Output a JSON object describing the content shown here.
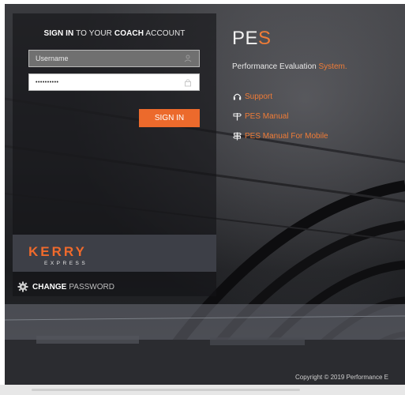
{
  "signin": {
    "prefix_bold": "SIGN IN",
    "middle": " TO YOUR ",
    "coach_bold": "COACH",
    "suffix": " ACCOUNT"
  },
  "username": {
    "placeholder": "Username"
  },
  "password": {
    "masked_value": "••••••••••"
  },
  "signin_button": "SIGN IN",
  "kerry": {
    "logo_text": "KERRY",
    "logo_sub": "EXPRESS"
  },
  "change_password": {
    "bold": "CHANGE",
    "rest": "PASSWORD"
  },
  "brand": {
    "title_main": "PE",
    "title_accent": "S",
    "subtitle_main": "Performance Evaluation ",
    "subtitle_accent": "System."
  },
  "links": [
    {
      "label": "Support",
      "icon": "headset-icon"
    },
    {
      "label": "PES Manual",
      "icon": "signpost-icon"
    },
    {
      "label": "PES Manual For Mobile",
      "icon": "signpost-double-icon"
    }
  ],
  "copyright": "Copyright © 2019 Performance E",
  "colors": {
    "accent": "#ec6a2c",
    "panel": "#141416",
    "kerry_bar": "#3d3f47"
  }
}
